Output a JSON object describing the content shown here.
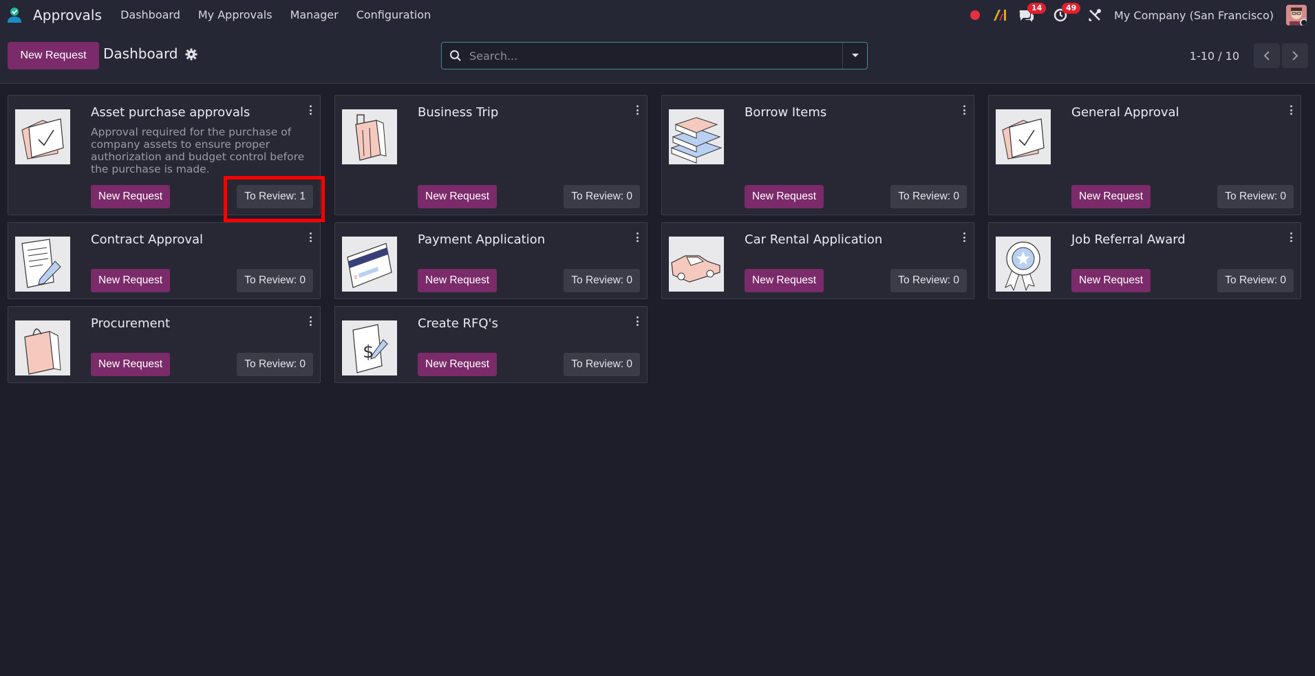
{
  "app": {
    "title": "Approvals"
  },
  "menu": [
    {
      "label": "Dashboard"
    },
    {
      "label": "My Approvals"
    },
    {
      "label": "Manager"
    },
    {
      "label": "Configuration"
    }
  ],
  "systray": {
    "messages_count": "14",
    "activities_count": "49",
    "company": "My Company (San Francisco)"
  },
  "control": {
    "new_request_label": "New Request",
    "breadcrumb": "Dashboard",
    "search_placeholder": "Search...",
    "pager": "1-10 / 10"
  },
  "cards": [
    {
      "title": "Asset purchase approvals",
      "description": "Approval required for the purchase of company assets to ensure proper authorization and budget control before the purchase is made.",
      "new_label": "New Request",
      "review_label": "To Review: 1",
      "icon": "folder-check-icon"
    },
    {
      "title": "Business Trip",
      "description": "",
      "new_label": "New Request",
      "review_label": "To Review: 0",
      "icon": "luggage-icon"
    },
    {
      "title": "Borrow Items",
      "description": "",
      "new_label": "New Request",
      "review_label": "To Review: 0",
      "icon": "books-icon"
    },
    {
      "title": "General Approval",
      "description": "",
      "new_label": "New Request",
      "review_label": "To Review: 0",
      "icon": "folder-check-icon"
    },
    {
      "title": "Contract Approval",
      "description": "",
      "new_label": "New Request",
      "review_label": "To Review: 0",
      "icon": "contract-icon"
    },
    {
      "title": "Payment Application",
      "description": "",
      "new_label": "New Request",
      "review_label": "To Review: 0",
      "icon": "credit-card-icon"
    },
    {
      "title": "Car Rental Application",
      "description": "",
      "new_label": "New Request",
      "review_label": "To Review: 0",
      "icon": "car-icon"
    },
    {
      "title": "Job Referral Award",
      "description": "",
      "new_label": "New Request",
      "review_label": "To Review: 0",
      "icon": "award-ribbon-icon"
    },
    {
      "title": "Procurement",
      "description": "",
      "new_label": "New Request",
      "review_label": "To Review: 0",
      "icon": "shopping-bag-icon"
    },
    {
      "title": "Create RFQ's",
      "description": "",
      "new_label": "New Request",
      "review_label": "To Review: 0",
      "icon": "dollar-document-icon"
    }
  ],
  "colors": {
    "primary": "#7b2a6a",
    "background": "#1e1e2a",
    "card": "#272834",
    "highlight": "#ff0000"
  }
}
